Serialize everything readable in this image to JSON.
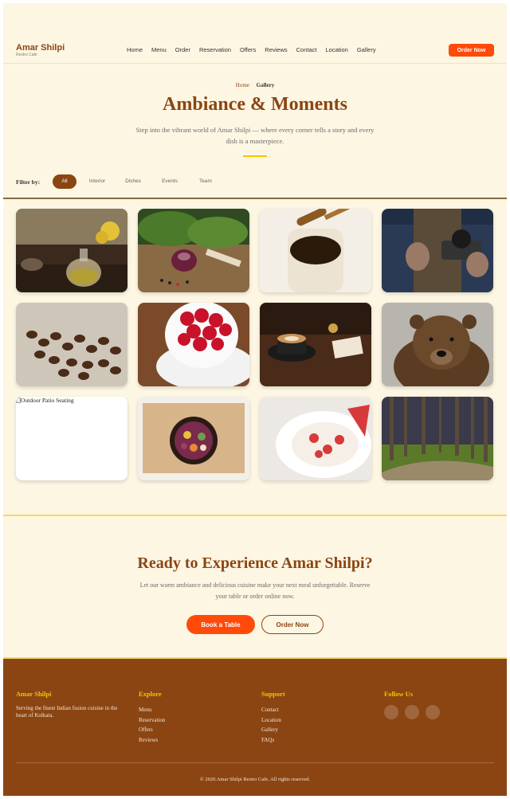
{
  "brand": {
    "name": "Amar Shilpi",
    "tagline": "Restro Cafe"
  },
  "nav": {
    "items": [
      "Home",
      "Menu",
      "Order",
      "Reservation",
      "Offers",
      "Reviews",
      "Contact",
      "Location",
      "Gallery"
    ]
  },
  "header": {
    "order_button": "Order Now"
  },
  "hero": {
    "breadcrumb_home": "Home",
    "breadcrumb_current": "Gallery",
    "title": "Ambiance & Moments",
    "subtitle": "Step into the vibrant world of Amar Shilpi — where every corner tells a story and every dish is a masterpiece."
  },
  "filter": {
    "label": "Filter by:",
    "options": [
      "All",
      "Interior",
      "Dishes",
      "Events",
      "Team"
    ],
    "active": "All"
  },
  "gallery": {
    "broken_image_alt": "Outdoor Patio Seating",
    "tiles": [
      "teapot-photo",
      "vegetables-photo",
      "honey-photo",
      "camera-photo",
      "coffee-beans-photo",
      "raspberries-photo",
      "latte-photo",
      "bear-photo",
      "broken-image",
      "salad-bowl-photo",
      "strawberry-yogurt-photo",
      "forest-path-photo"
    ]
  },
  "cta": {
    "title": "Ready to Experience Amar Shilpi?",
    "text": "Let our warm ambiance and delicious cuisine make your next meal unforgettable. Reserve your table or order online now.",
    "book_button": "Book a Table",
    "order_button": "Order Now"
  },
  "footer": {
    "brand_heading": "Amar Shilpi",
    "brand_text": "Serving the finest Indian fusion cuisine in the heart of Kolkata.",
    "explore_heading": "Explore",
    "explore_links": [
      "Menu",
      "Reservation",
      "Offers",
      "Reviews"
    ],
    "support_heading": "Support",
    "support_links": [
      "Contact",
      "Location",
      "Gallery",
      "FAQs"
    ],
    "follow_heading": "Follow Us",
    "socials": [
      "",
      "",
      ""
    ],
    "copyright": "© 2026 Amar Shilpi Restro Cafe. All rights reserved."
  },
  "colors": {
    "brand_brown": "#8b4513",
    "accent_orange": "#ff4a0a",
    "gold": "#f5c400",
    "cream_bg": "#fdf6e3"
  }
}
